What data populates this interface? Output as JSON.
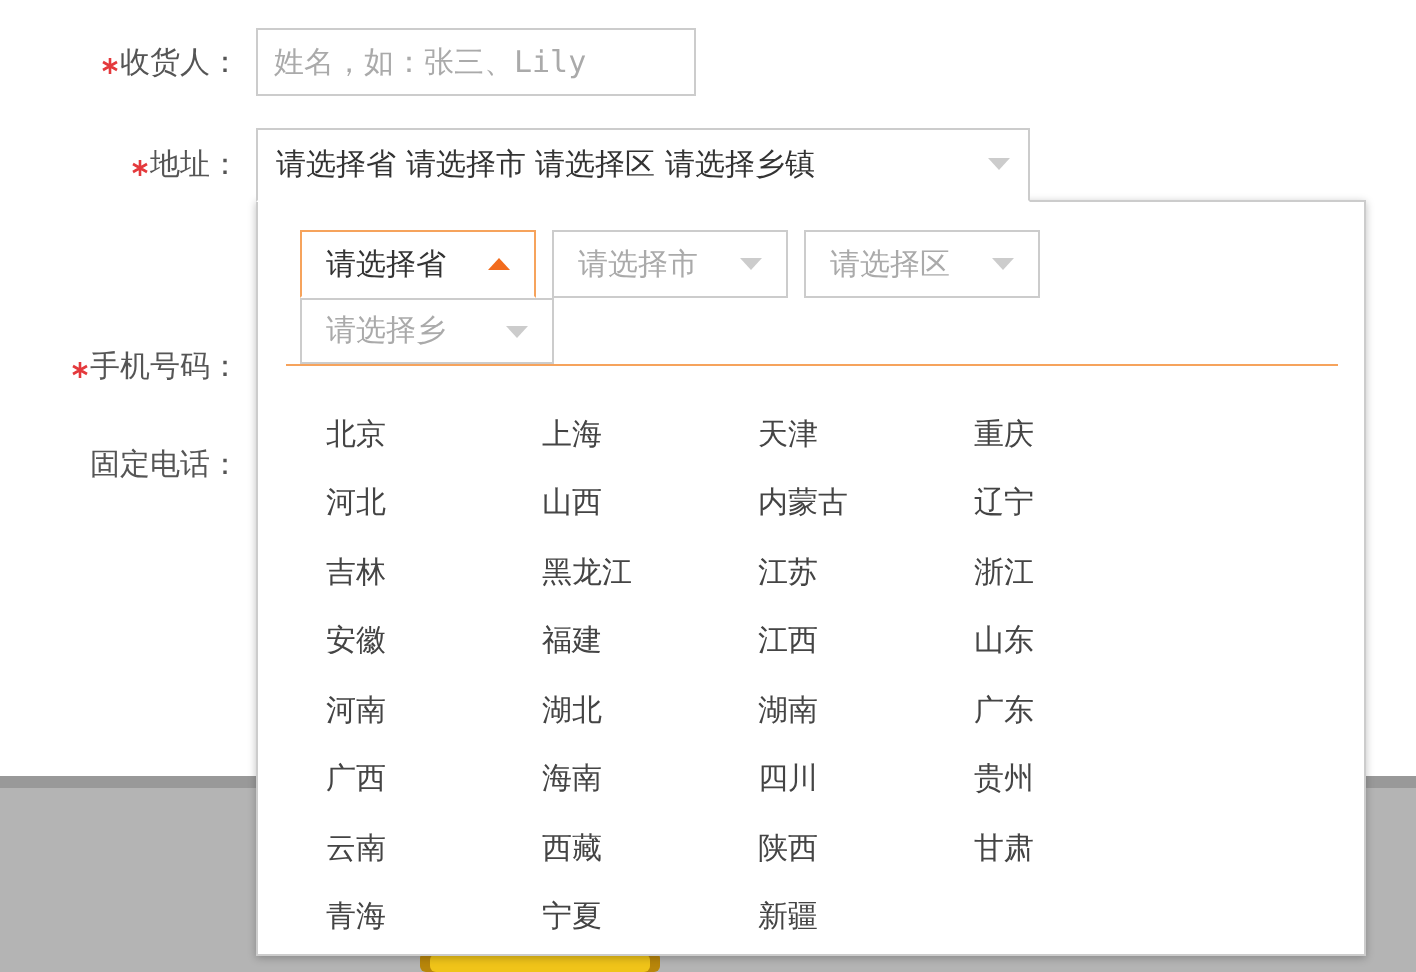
{
  "form": {
    "fields": [
      {
        "kind": "text",
        "label": "收货人：",
        "required": true,
        "placeholder": "姓名，如：张三、Lily"
      },
      {
        "kind": "select",
        "label": "地址：",
        "required": true,
        "value": "请选择省 请选择市 请选择区 请选择乡镇",
        "expanded": true
      },
      {
        "kind": "text",
        "label": "手机号码：",
        "required": true
      },
      {
        "kind": "text",
        "label": "固定电话：",
        "required": false
      }
    ]
  },
  "address_picker": {
    "tabs": [
      {
        "label": "请选择省",
        "selected": true
      },
      {
        "label": "请选择市",
        "selected": false
      },
      {
        "label": "请选择区",
        "selected": false
      },
      {
        "label": "请选择乡",
        "selected": false
      }
    ],
    "options": [
      "北京",
      "上海",
      "天津",
      "重庆",
      "河北",
      "山西",
      "内蒙古",
      "辽宁",
      "吉林",
      "黑龙江",
      "江苏",
      "浙江",
      "安徽",
      "福建",
      "江西",
      "山东",
      "河南",
      "湖北",
      "湖南",
      "广东",
      "广西",
      "海南",
      "四川",
      "贵州",
      "云南",
      "西藏",
      "陕西",
      "甘肃",
      "青海",
      "宁夏",
      "新疆"
    ]
  }
}
